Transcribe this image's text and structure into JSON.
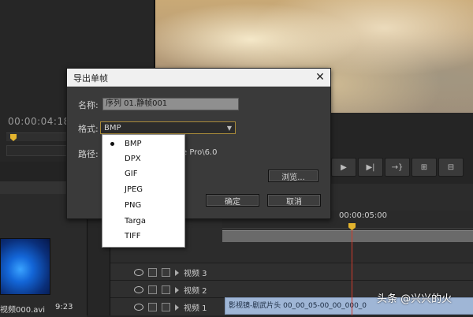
{
  "source_monitor": {
    "timecode": "00:00:04:18"
  },
  "program_monitor": {
    "buttons": [
      {
        "icon": "play-icon",
        "glyph": "▶"
      },
      {
        "icon": "step-forward-icon",
        "glyph": "▶|"
      },
      {
        "icon": "go-to-out-icon",
        "glyph": "→}"
      },
      {
        "icon": "insert-icon",
        "glyph": "⊞"
      },
      {
        "icon": "overwrite-icon",
        "glyph": "⊟"
      }
    ]
  },
  "project": {
    "file_name": "视频000.avi",
    "file_duration": "9:23"
  },
  "timeline": {
    "timecode": "00:00:05:00",
    "tracks": [
      {
        "label": "视频 3"
      },
      {
        "label": "视频 2"
      },
      {
        "label": "视频 1"
      }
    ],
    "clip_label": "影视镜-剧武片头 00_00_05-00_00_000_0"
  },
  "dialog": {
    "title": "导出单帧",
    "close_glyph": "✕",
    "name_label": "名称:",
    "name_value": "序列 01.静帧001",
    "format_label": "格式:",
    "format_value": "BMP",
    "path_label": "路径:",
    "path_value": "e Pro\\6.0",
    "browse_label": "浏览...",
    "ok_label": "确定",
    "cancel_label": "取消"
  },
  "format_options": [
    "BMP",
    "DPX",
    "GIF",
    "JPEG",
    "PNG",
    "Targa",
    "TIFF"
  ],
  "format_selected": "BMP",
  "watermark": "头条 @兴兴的火"
}
